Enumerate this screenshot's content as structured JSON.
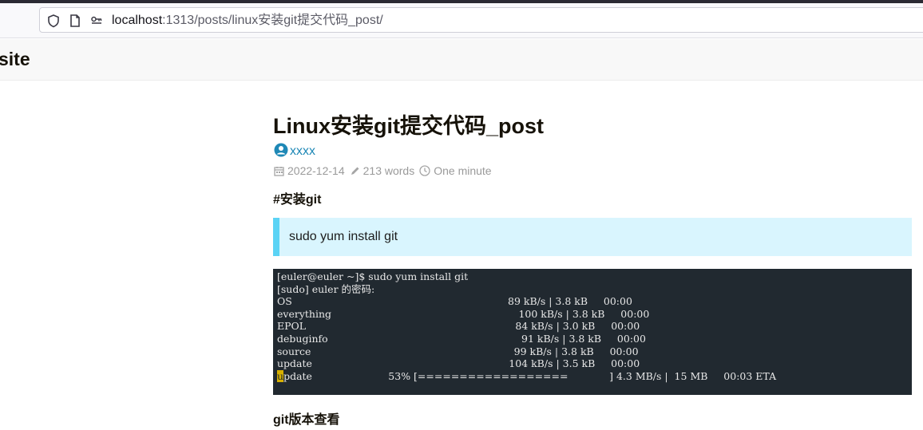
{
  "browser": {
    "url_host": "localhost",
    "url_path": ":1313/posts/linux安装git提交代码_post/"
  },
  "site": {
    "brand": "site"
  },
  "post": {
    "title": "Linux安装git提交代码_post",
    "author": "xxxx",
    "date": "2022-12-14",
    "words": "213 words",
    "reading_time": "One minute",
    "heading_install": "#安装git",
    "quote_text": "sudo yum install git",
    "heading_version": "git版本查看"
  },
  "terminal": {
    "prompt_pre": "[euler",
    "prompt_post": "euler ~]$ sudo yum install git",
    "lines": [
      "[sudo] euler 的密码:",
      "OS                                                                    89 kB/s | 3.8 kB     00:00",
      "everything                                                           100 kB/s | 3.8 kB     00:00",
      "EPOL                                                                  84 kB/s | 3.0 kB     00:00",
      "debuginfo                                                             91 kB/s | 3.8 kB     00:00",
      "source                                                                99 kB/s | 3.8 kB     00:00",
      "update                                                              104 kB/s | 3.5 kB     00:00"
    ],
    "last_cursor_char": "u",
    "last_line_rest": "pdate                        53% [==================             ] 4.3 MB/s |  15 MB     00:03 ETA"
  },
  "icons": {
    "shield": "shield-icon",
    "page": "page-icon",
    "permissions": "permissions-icon",
    "user": "user-circle-icon",
    "calendar": "calendar-icon",
    "pencil": "pencil-icon",
    "clock": "clock-icon"
  },
  "colors": {
    "link": "#1e88b6",
    "quote_bg": "#d9f5fe",
    "quote_border": "#5bd3f5",
    "terminal_bg": "#212930"
  }
}
